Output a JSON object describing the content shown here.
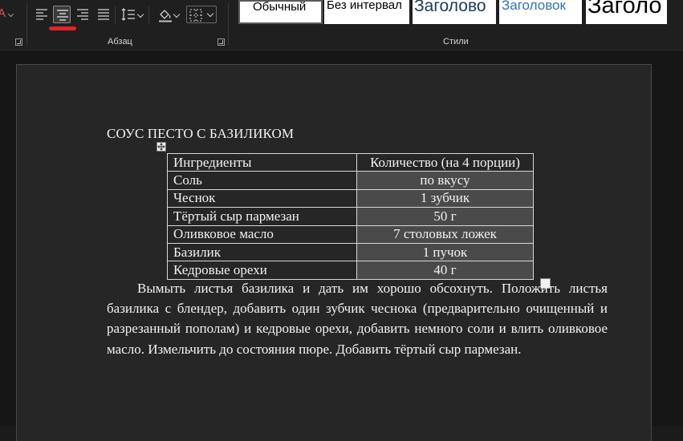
{
  "ribbon": {
    "paragraph_group_label": "Абзац",
    "styles_group_label": "Стили",
    "styles": [
      {
        "label": "Обычный",
        "color": "#000000"
      },
      {
        "label": "Без интервал",
        "color": "#000000"
      },
      {
        "label": "Заголово",
        "color": "#1f3864"
      },
      {
        "label": "Заголовок",
        "color": "#2e74b5"
      },
      {
        "label": "Заголо",
        "color": "#000000"
      }
    ],
    "font_color_swatch": "#e05050",
    "annotation_color": "#e0242b"
  },
  "document": {
    "title": "СОУС ПЕСТО С БАЗИЛИКОМ",
    "table": {
      "headers": [
        "Ингредиенты",
        "Количество (на 4 порции)"
      ],
      "rows": [
        [
          "Соль",
          "по вкусу"
        ],
        [
          "Чеснок",
          "1 зубчик"
        ],
        [
          "Тёртый сыр пармезан",
          "50 г"
        ],
        [
          "Оливковое масло",
          "7 столовых ложек"
        ],
        [
          "Базилик",
          "1 пучок"
        ],
        [
          "Кедровые орехи",
          "40 г"
        ]
      ]
    },
    "paragraph": "Вымыть листья базилика и дать им хорошо обсохнуть. Положить листья базилика с блендер, добавить один зубчик чеснока (предварительно очищенный и разрезанный пополам) и кедровые орехи, добавить немного соли и влить оливковое масло. Измельчить до состояния пюре. Добавить тёртый сыр пармезан."
  }
}
